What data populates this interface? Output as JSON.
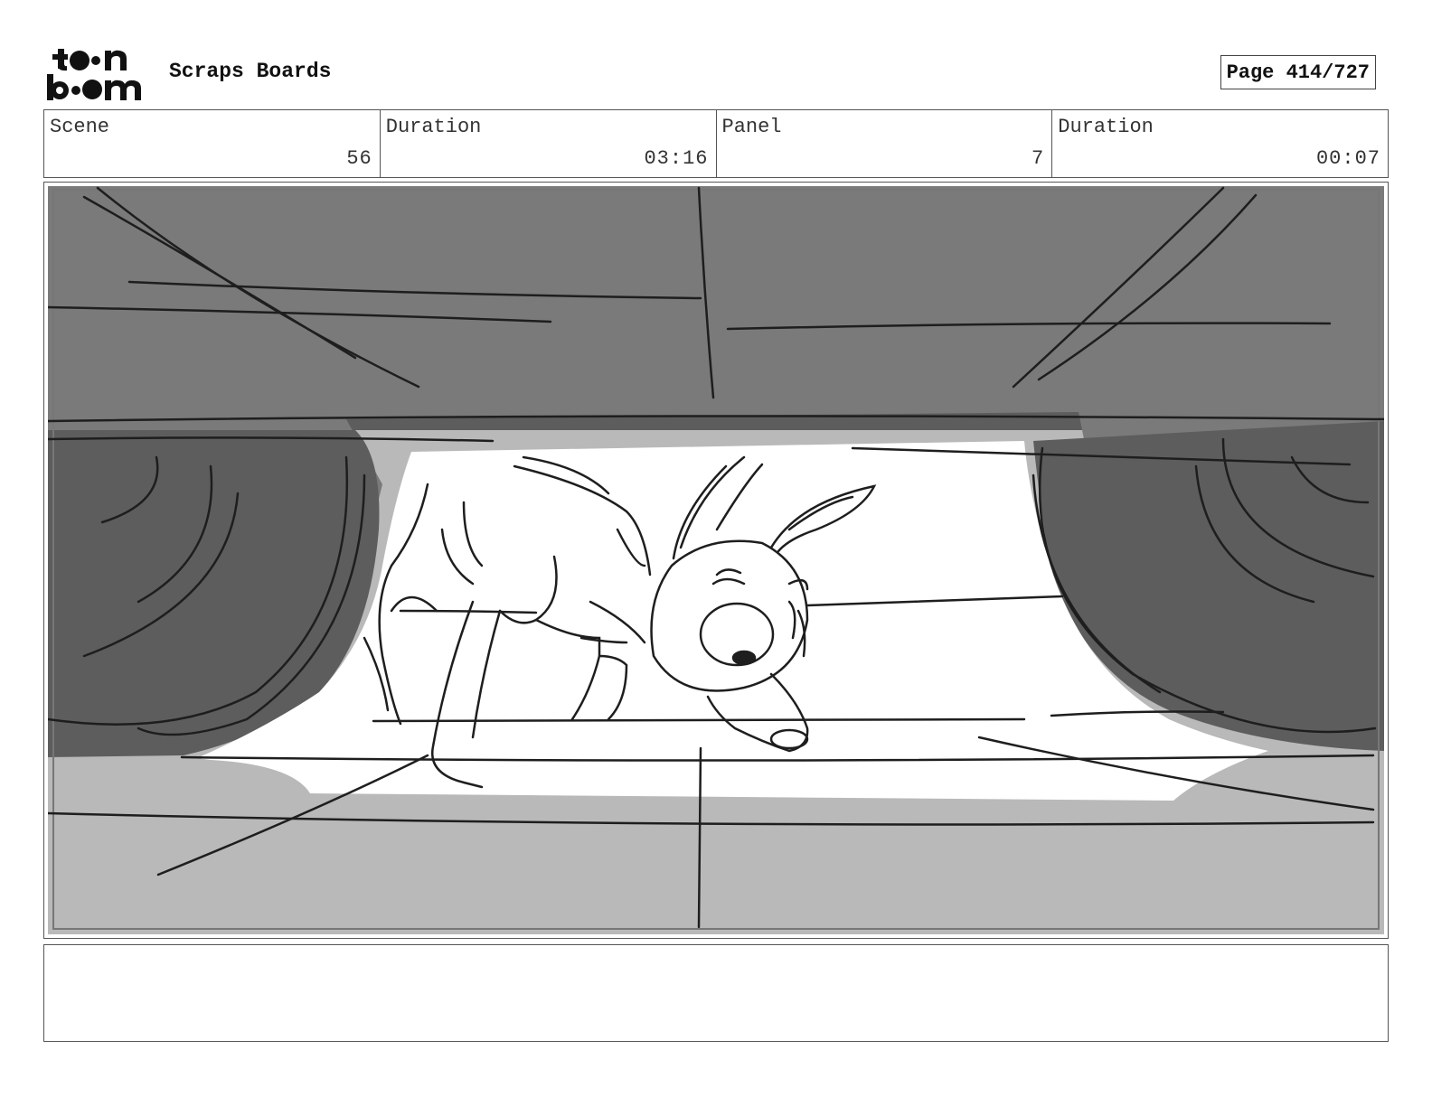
{
  "header": {
    "logo_text": "toon boom",
    "title": "Scraps Boards",
    "page_label": "Page",
    "page_number": "414/727"
  },
  "info": {
    "scene_label": "Scene",
    "scene_value": "56",
    "scene_duration_label": "Duration",
    "scene_duration_value": "03:16",
    "panel_label": "Panel",
    "panel_value": "7",
    "panel_duration_label": "Duration",
    "panel_duration_value": "00:07"
  },
  "panel": {
    "image_subject": "storyboard sketch of a small dog sniffing the ground under a car, framed between the tires"
  },
  "notes": {
    "text": ""
  },
  "colors": {
    "car_dark": "#5d5d5d",
    "car_mid": "#7a7a7a",
    "ground": "#b9b9b9",
    "line": "#1e1e1e"
  }
}
